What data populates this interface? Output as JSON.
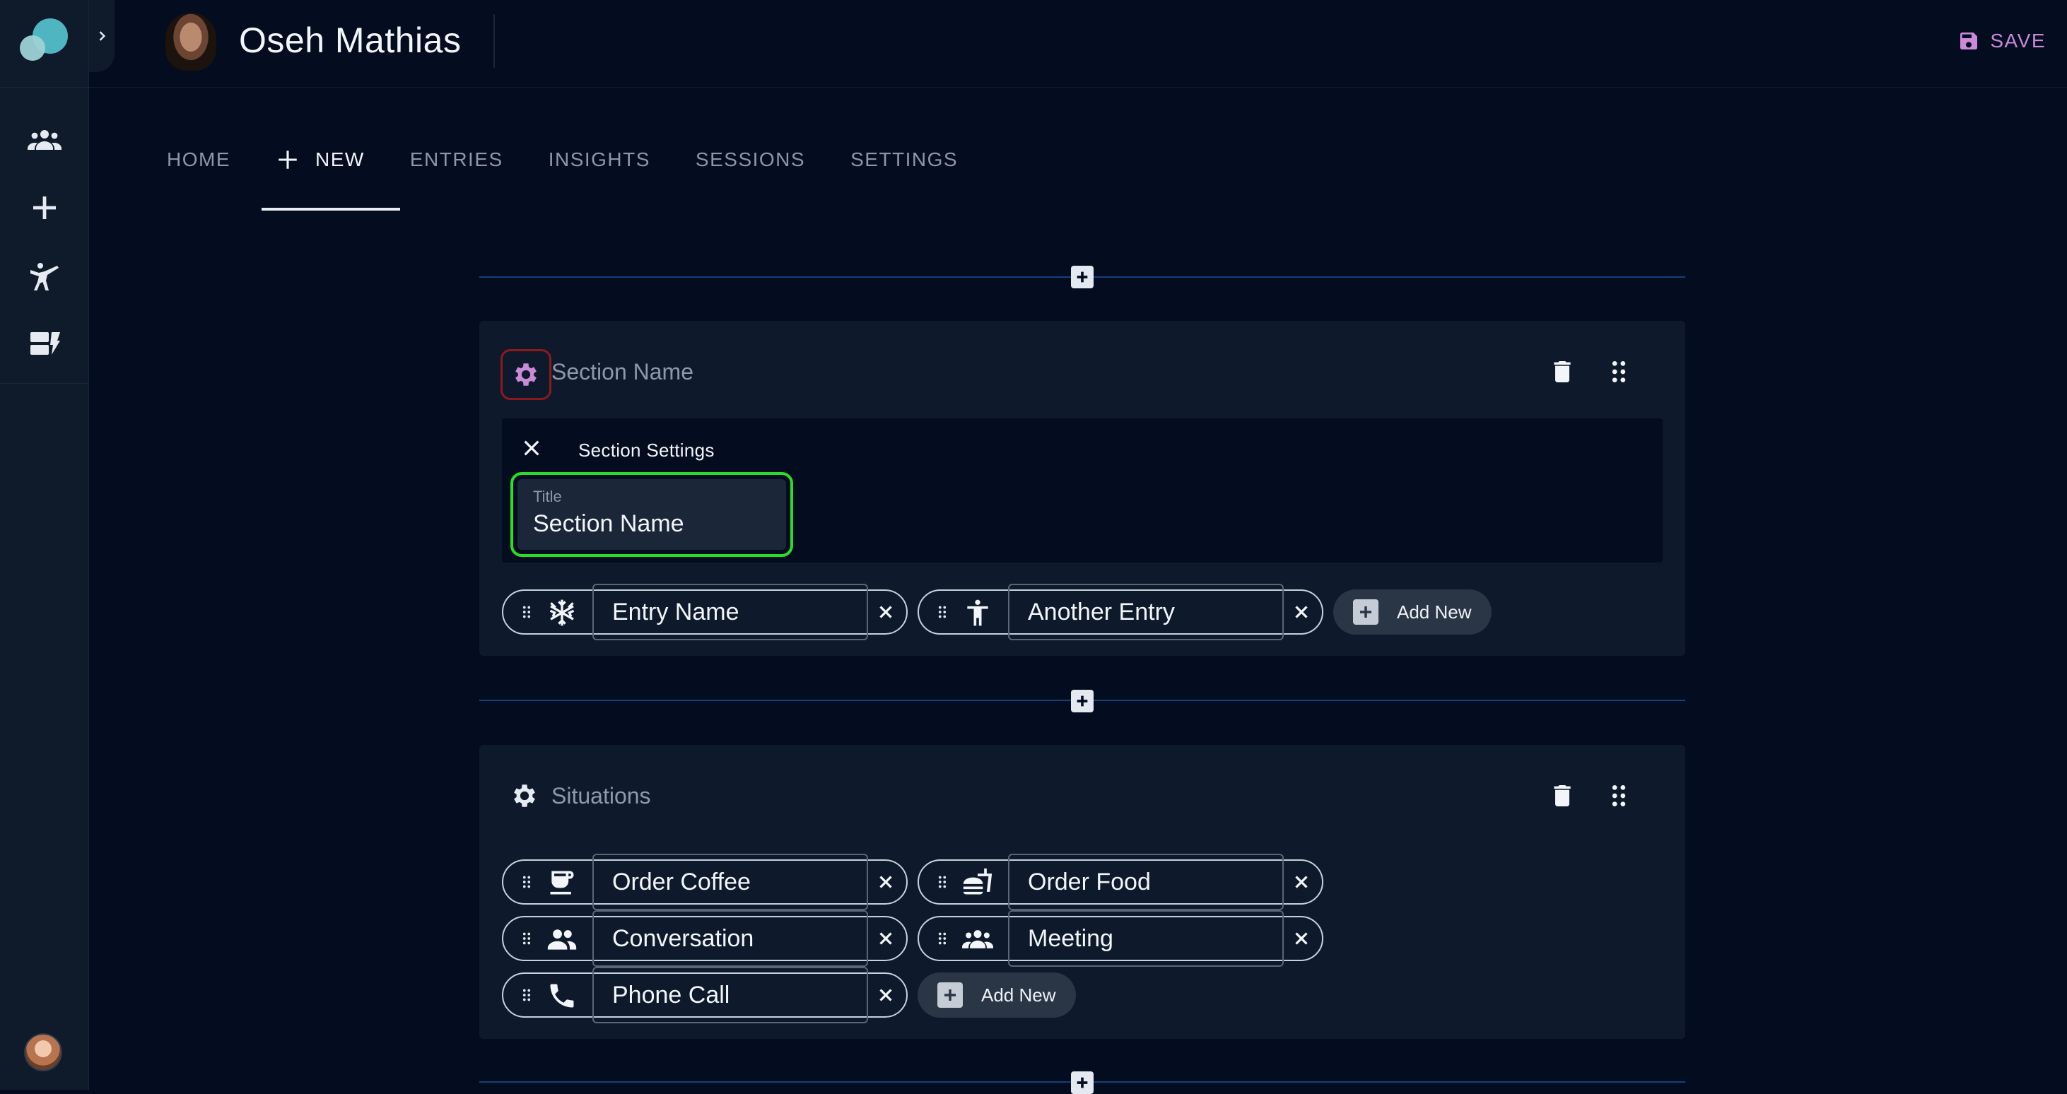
{
  "profile": {
    "name": "Oseh Mathias"
  },
  "toolbar": {
    "save_label": "SAVE"
  },
  "tabs": [
    {
      "label": "HOME",
      "active": false
    },
    {
      "label": "NEW",
      "active": true
    },
    {
      "label": "ENTRIES",
      "active": false
    },
    {
      "label": "INSIGHTS",
      "active": false
    },
    {
      "label": "SESSIONS",
      "active": false
    },
    {
      "label": "SETTINGS",
      "active": false
    }
  ],
  "sections": [
    {
      "title": "Section Name",
      "settings_open": true,
      "settings": {
        "heading": "Section Settings",
        "title_field": {
          "label": "Title",
          "value": "Section Name"
        }
      },
      "entries": [
        {
          "name": "Entry Name",
          "icon": "snowflake-icon"
        },
        {
          "name": "Another Entry",
          "icon": "accessibility-icon"
        }
      ],
      "add_label": "Add New"
    },
    {
      "title": "Situations",
      "settings_open": false,
      "entries": [
        {
          "name": "Order Coffee",
          "icon": "coffee-cup-icon"
        },
        {
          "name": "Order Food",
          "icon": "fastfood-icon"
        },
        {
          "name": "Conversation",
          "icon": "people-icon"
        },
        {
          "name": "Meeting",
          "icon": "group-icon"
        },
        {
          "name": "Phone Call",
          "icon": "phone-icon"
        }
      ],
      "add_label": "Add New"
    }
  ],
  "colors": {
    "background": "#030d1f",
    "rail": "#0f1a2b",
    "card": "#0e1a2c",
    "accent_save": "#c98ad8",
    "gear": "#c98ad8",
    "focus_outline": "#2bdc28",
    "gear_highlight": "#8a1a1d",
    "divider": "#15407e"
  }
}
